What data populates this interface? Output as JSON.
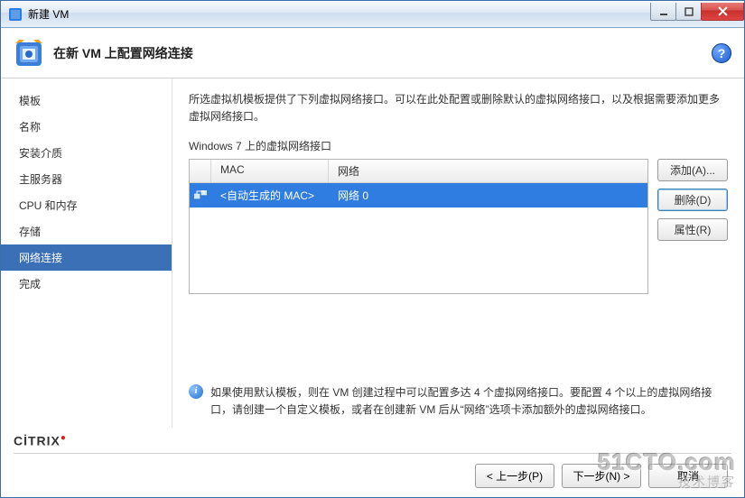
{
  "window": {
    "title": "新建 VM"
  },
  "header": {
    "title": "在新 VM 上配置网络连接"
  },
  "sidebar": {
    "items": [
      {
        "label": "模板"
      },
      {
        "label": "名称"
      },
      {
        "label": "安装介质"
      },
      {
        "label": "主服务器"
      },
      {
        "label": "CPU 和内存"
      },
      {
        "label": "存储"
      },
      {
        "label": "网络连接",
        "active": true
      },
      {
        "label": "完成"
      }
    ]
  },
  "content": {
    "description": "所选虚拟机模板提供了下列虚拟网络接口。可以在此处配置或删除默认的虚拟网络接口，以及根据需要添加更多虚拟网络接口。",
    "subheading": "Windows 7 上的虚拟网络接口",
    "columns": {
      "mac": "MAC",
      "network": "网络"
    },
    "rows": [
      {
        "mac": "<自动生成的 MAC>",
        "network": "网络 0",
        "selected": true
      }
    ],
    "buttons": {
      "add": "添加(A)...",
      "delete": "删除(D)",
      "props": "属性(R)"
    },
    "info": "如果使用默认模板，则在 VM 创建过程中可以配置多达 4 个虚拟网络接口。要配置 4 个以上的虚拟网络接口，请创建一个自定义模板，或者在创建新 VM 后从“网络”选项卡添加额外的虚拟网络接口。"
  },
  "footer": {
    "brand": "CİTRIX",
    "prev": "< 上一步(P)",
    "next": "下一步(N) >",
    "cancel": "取消"
  },
  "watermark": {
    "line1": "51CTO.com",
    "line2": "技术博客"
  }
}
